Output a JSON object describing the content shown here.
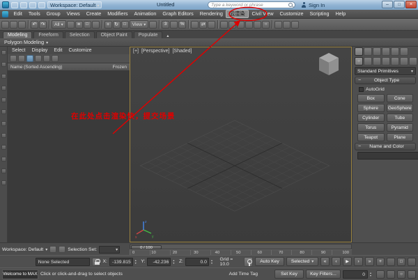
{
  "titlebar": {
    "workspace_label": "Workspace: Default",
    "title": "Untitled",
    "search_placeholder": "Type a keyword or phrase",
    "sign_in_label": "Sign In"
  },
  "menubar": {
    "items": [
      "Edit",
      "Tools",
      "Group",
      "Views",
      "Create",
      "Modifiers",
      "Animation",
      "Graph Editors",
      "Rendering",
      "云渲染",
      "Civil View",
      "Customize",
      "Scripting",
      "Help"
    ]
  },
  "toolbar": {
    "selection_filter": "All",
    "coordinate_system": "View"
  },
  "ribbon": {
    "tabs": [
      "Modeling",
      "Freeform",
      "Selection",
      "Object Paint",
      "Populate"
    ],
    "panel": "Polygon Modeling"
  },
  "explorer": {
    "menus": [
      "Select",
      "Display",
      "Edit",
      "Customize"
    ],
    "name_header": "Name (Sorted Ascending)",
    "frozen_header": "Frozen"
  },
  "viewport": {
    "labels": [
      "[+]",
      "[Perspective]",
      "[Shaded]"
    ]
  },
  "annotation": {
    "text": "在此处点击渲染快，提交场景",
    "color": "#e00000"
  },
  "command_panel": {
    "category_dropdown": "Standard Primitives",
    "object_type_rollout": "Object Type",
    "autogrid_label": "AutoGrid",
    "object_buttons": [
      "Box",
      "Cone",
      "Sphere",
      "GeoSphere",
      "Cylinder",
      "Tube",
      "Torus",
      "Pyramid",
      "Teapot",
      "Plane"
    ],
    "name_color_rollout": "Name and Color",
    "swatch_color": "#e0138c"
  },
  "timeline": {
    "slider": "0 / 100",
    "ticks": [
      "0",
      "10",
      "20",
      "30",
      "40",
      "50",
      "60",
      "70",
      "80",
      "90",
      "100"
    ]
  },
  "statusbar": {
    "workspace": "Workspace: Default",
    "selection_set_label": "Selection Set:",
    "status": "None Selected",
    "x_label": "X:",
    "x_value": "-139.815",
    "y_label": "Y:",
    "y_value": "-42.236",
    "z_label": "Z:",
    "z_value": "0.0",
    "grid": "Grid = 10.0",
    "welcome": "Welcome to MAX",
    "prompt": "Click or click-and-drag to select objects",
    "add_time_tag": "Add Time Tag",
    "auto_key": "Auto Key",
    "set_key": "Set Key",
    "selected": "Selected",
    "key_filters": "Key Filters...",
    "frame": "0"
  }
}
